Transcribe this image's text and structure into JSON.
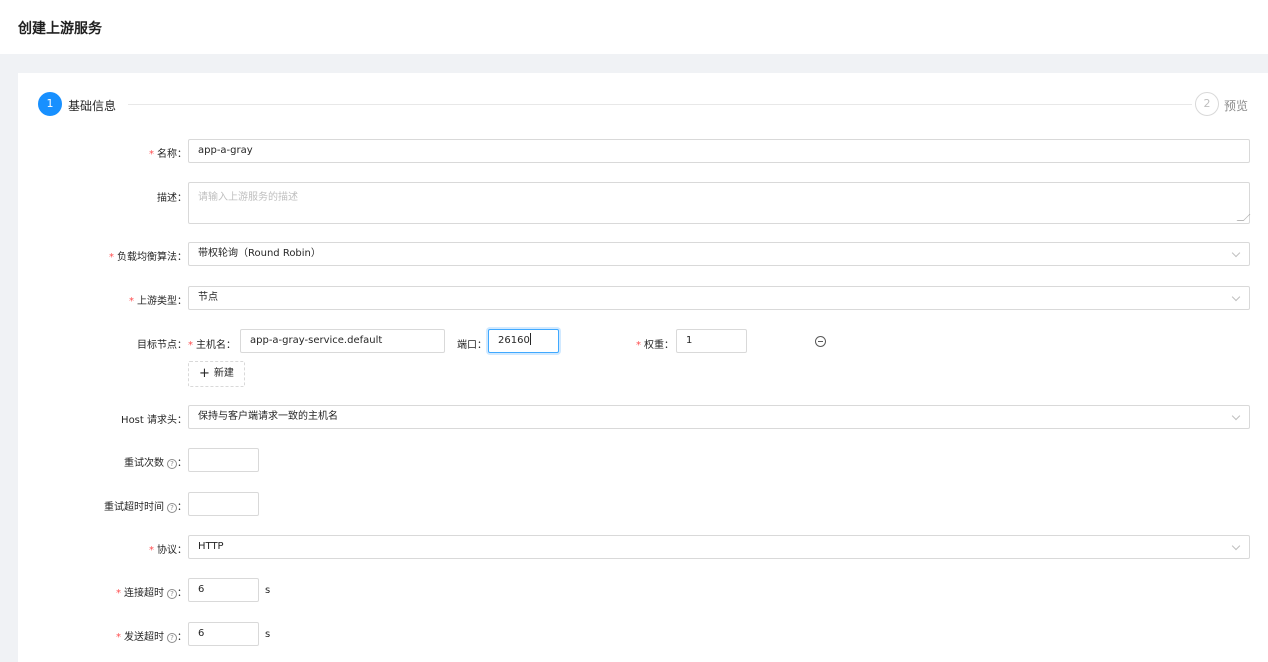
{
  "header": {
    "title": "创建上游服务"
  },
  "steps": [
    {
      "number": "1",
      "title": "基础信息"
    },
    {
      "number": "2",
      "title": "预览"
    }
  ],
  "form": {
    "name": {
      "label": "名称",
      "value": "app-a-gray"
    },
    "description": {
      "label": "描述",
      "placeholder": "请输入上游服务的描述"
    },
    "algorithm": {
      "label": "负载均衡算法",
      "value": "带权轮询（Round Robin）"
    },
    "upstream_type": {
      "label": "上游类型",
      "value": "节点"
    },
    "target_node": {
      "label": "目标节点",
      "host_label": "主机名",
      "host_value": "app-a-gray-service.default",
      "port_label": "端口",
      "port_value": "26160",
      "weight_label": "权重",
      "weight_value": "1",
      "add_label": "新建"
    },
    "host_header": {
      "label": "Host 请求头",
      "value": "保持与客户端请求一致的主机名"
    },
    "retries": {
      "label": "重试次数",
      "value": ""
    },
    "retry_timeout": {
      "label": "重试超时时间",
      "value": ""
    },
    "protocol": {
      "label": "协议",
      "value": "HTTP"
    },
    "connect_timeout": {
      "label": "连接超时",
      "value": "6",
      "unit": "s"
    },
    "send_timeout": {
      "label": "发送超时",
      "value": "6",
      "unit": "s"
    }
  },
  "colors": {
    "primary": "#1890ff",
    "required": "#ff4d4f",
    "border": "#d9d9d9"
  },
  "icons": [
    "question-circle-icon",
    "minus-circle-icon",
    "plus-icon",
    "chevron-down-icon"
  ]
}
